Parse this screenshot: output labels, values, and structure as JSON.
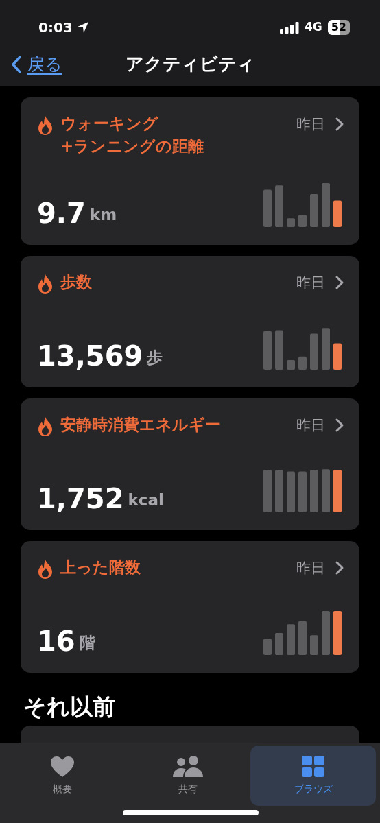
{
  "status_bar": {
    "time": "0:03",
    "network": "4G",
    "battery": "52"
  },
  "nav": {
    "back": "戻る",
    "title": "アクティビティ"
  },
  "cards": [
    {
      "title": "ウォーキング\n+ランニングの距離",
      "date": "昨日",
      "value": "9.7",
      "unit": "km"
    },
    {
      "title": "歩数",
      "date": "昨日",
      "value": "13,569",
      "unit": "歩"
    },
    {
      "title": "安静時消費エネルギー",
      "date": "昨日",
      "value": "1,752",
      "unit": "kcal"
    },
    {
      "title": "上った階数",
      "date": "昨日",
      "value": "16",
      "unit": "階"
    }
  ],
  "section_title": "それ以前",
  "tabs": [
    {
      "label": "概要",
      "selected": false
    },
    {
      "label": "共有",
      "selected": false
    },
    {
      "label": "ブラウズ",
      "selected": true
    }
  ]
}
